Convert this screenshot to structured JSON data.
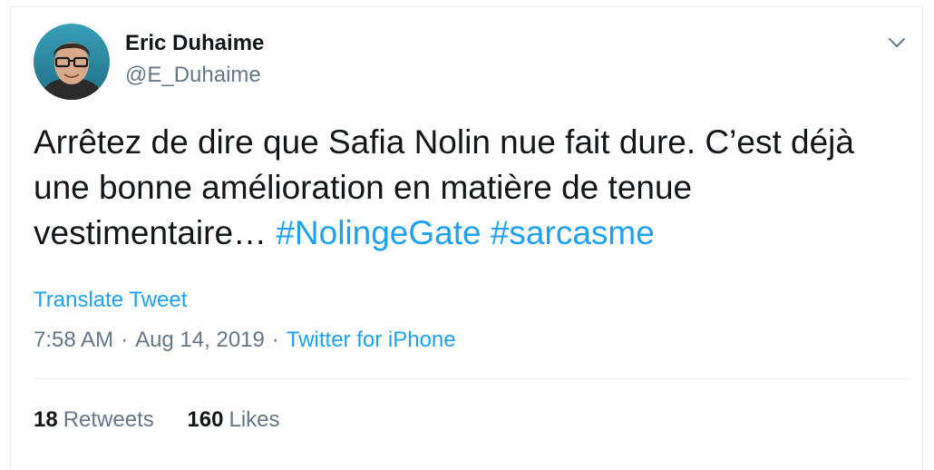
{
  "tweet": {
    "author_name": "Eric Duhaime",
    "author_handle": "@E_Duhaime",
    "text_part": "Arrêtez de dire que Safia Nolin nue fait dure. C’est déjà une bonne amélioration en matière de tenue vestimentaire…",
    "hashtags": [
      "#NolingeGate",
      "#sarcasme"
    ],
    "translate_label": "Translate Tweet",
    "time": "7:58 AM",
    "date": "Aug 14, 2019",
    "separator": "·",
    "source": "Twitter for iPhone",
    "retweets_count": "18",
    "retweets_label": "Retweets",
    "likes_count": "160",
    "likes_label": "Likes"
  },
  "icons": {
    "avatar": "avatar-photo",
    "menu": "chevron-down-icon"
  },
  "colors": {
    "link": "#1da1f2",
    "secondary_text": "#657786",
    "primary_text": "#14171a",
    "border": "#e6ecf0"
  }
}
